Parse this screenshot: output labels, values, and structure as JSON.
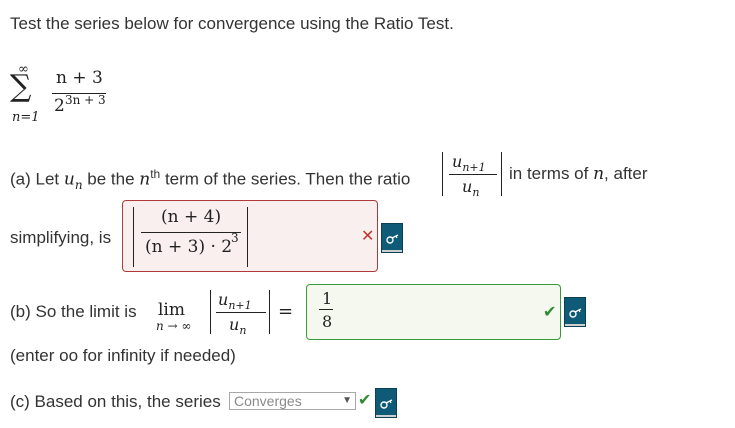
{
  "prompt": "Test the series below for convergence using the Ratio Test.",
  "series": {
    "sum_symbol": "∑",
    "upper": "∞",
    "lower": "n=1",
    "numerator": "n + 3",
    "denominator_base": "2",
    "denominator_exp": "3n + 3"
  },
  "part_a": {
    "text_before": "(a) Let ",
    "u": "u",
    "sub_n": "n",
    "text_be_the": " be the ",
    "n_var": "n",
    "sup_th": "th",
    "text_term": " term of the series. Then the ratio",
    "ratio_num_u": "u",
    "ratio_num_sub": "n+1",
    "ratio_den_u": "u",
    "ratio_den_sub": "n",
    "text_in_terms": "in terms of ",
    "text_n": "n",
    "text_after": ", after",
    "text_simplifying": "simplifying, is",
    "answer_num": "(n + 4)",
    "answer_den_main": "(n + 3) · 2",
    "answer_den_exp": "3",
    "status": "incorrect",
    "status_mark": "✕"
  },
  "part_b": {
    "text": "(b) So the limit is",
    "lim": "lim",
    "lim_sub": "n → ∞",
    "ratio_num_u": "u",
    "ratio_num_sub": "n+1",
    "ratio_den_u": "u",
    "ratio_den_sub": "n",
    "equals": "=",
    "answer_num": "1",
    "answer_den": "8",
    "status": "correct",
    "status_mark": "✔",
    "note": "(enter oo for infinity if needed)"
  },
  "part_c": {
    "text": "(c) Based on this, the series",
    "select_value": "Converges",
    "status_mark": "✔"
  },
  "icons": {
    "key_button": "key-icon",
    "incorrect": "cross-icon",
    "correct": "checkmark-icon"
  },
  "colors": {
    "incorrect_border": "#b03a3a",
    "incorrect_bg": "#f8efee",
    "correct_border": "#3a9a3a",
    "correct_bg": "#f4f8ee",
    "key_button_bg": "#0e5a77",
    "incorrect_mark": "#c0392b",
    "correct_mark": "#2e8b2e"
  }
}
